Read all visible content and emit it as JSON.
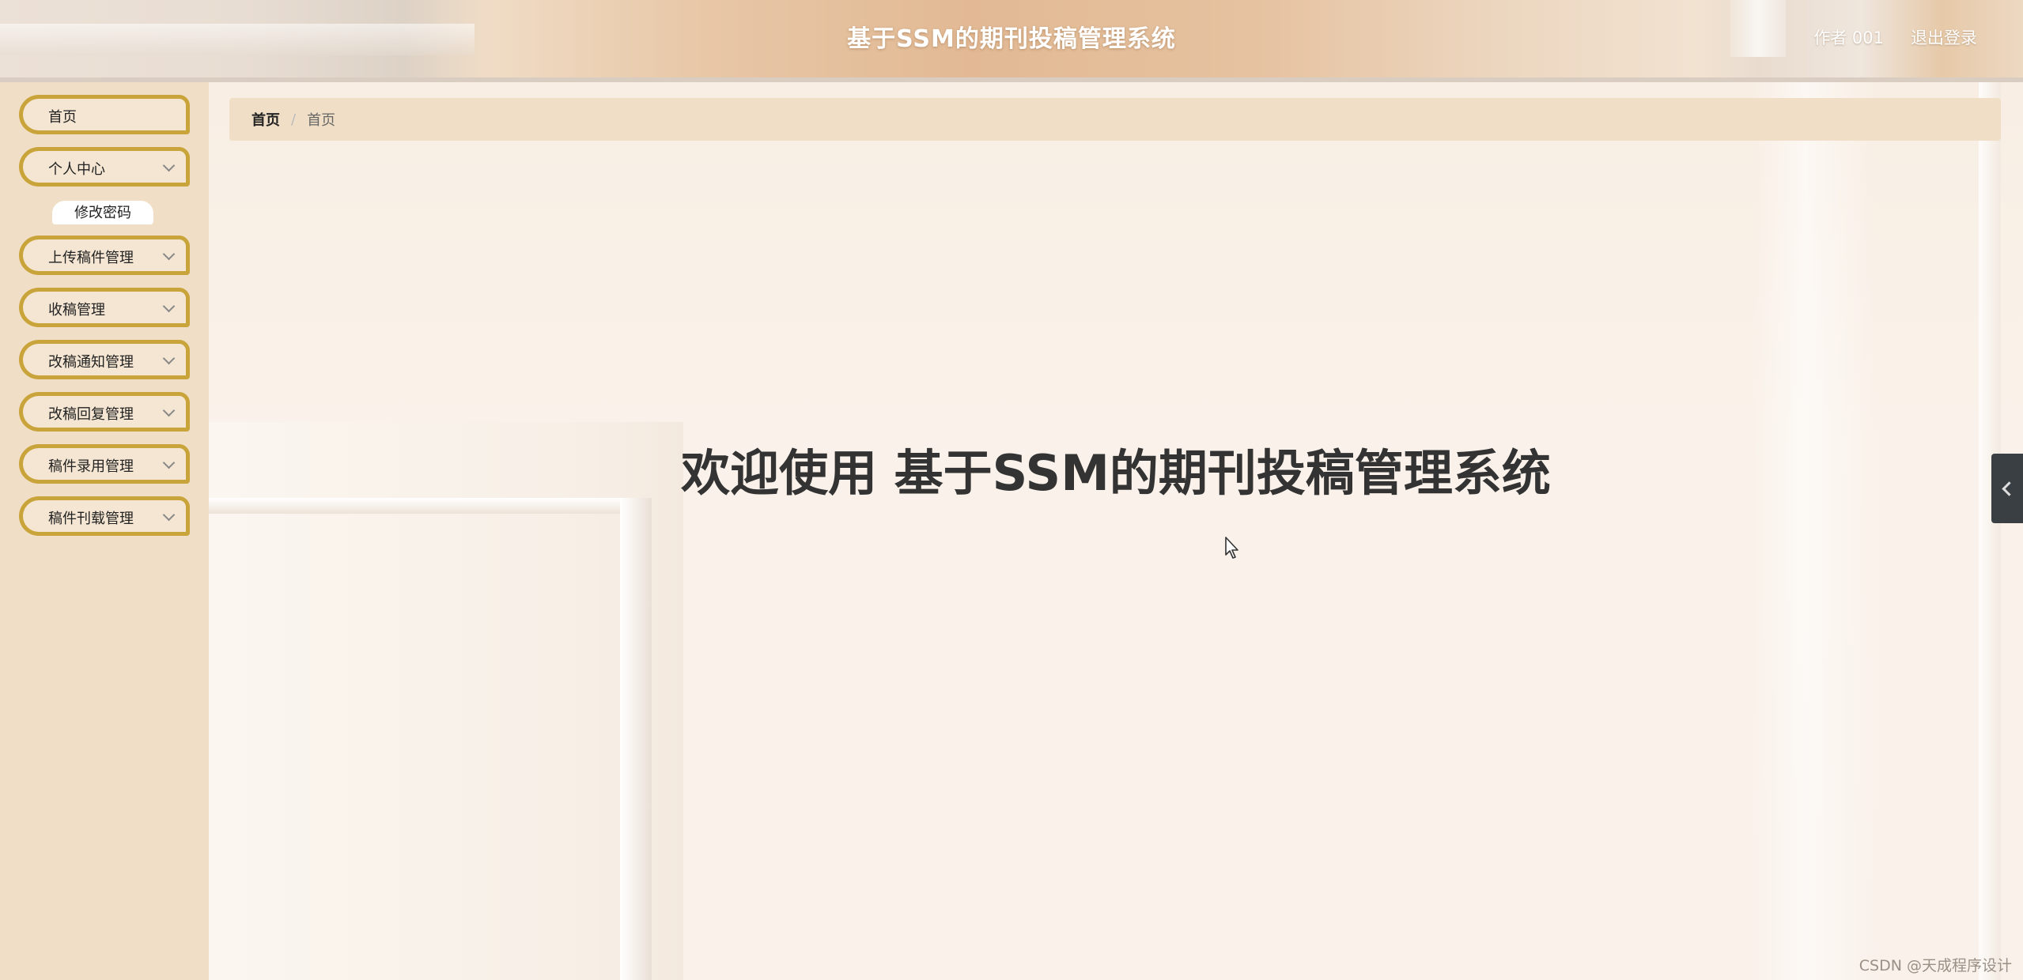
{
  "header": {
    "title": "基于SSM的期刊投稿管理系统",
    "user": "作者 001",
    "logout": "退出登录"
  },
  "sidebar": {
    "items": [
      {
        "label": "首页",
        "has_submenu": false
      },
      {
        "label": "个人中心",
        "has_submenu": true,
        "expanded": true,
        "submenu": [
          {
            "label": "修改密码"
          }
        ]
      },
      {
        "label": "上传稿件管理",
        "has_submenu": true
      },
      {
        "label": "收稿管理",
        "has_submenu": true
      },
      {
        "label": "改稿通知管理",
        "has_submenu": true
      },
      {
        "label": "改稿回复管理",
        "has_submenu": true
      },
      {
        "label": "稿件录用管理",
        "has_submenu": true
      },
      {
        "label": "稿件刊载管理",
        "has_submenu": true
      }
    ]
  },
  "breadcrumb": {
    "home": "首页",
    "separator": "/",
    "current": "首页"
  },
  "main": {
    "welcome": "欢迎使用 基于SSM的期刊投稿管理系统"
  },
  "watermark": "CSDN @天成程序设计",
  "colors": {
    "sidebar_bg": "#f0dfc6",
    "menu_border": "#c9a43b",
    "breadcrumb_bg": "#f0dfc6",
    "title_text": "#ffffff",
    "welcome_text": "#333333"
  }
}
